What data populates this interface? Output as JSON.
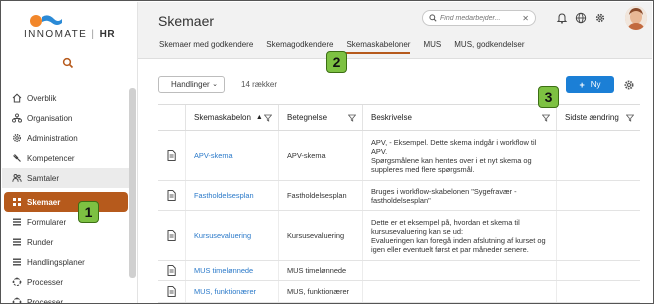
{
  "app": {
    "logo_text": "INNOMATE",
    "logo_hr": "HR"
  },
  "sidebar": {
    "items": [
      {
        "label": "Overblik",
        "icon": "home-icon"
      },
      {
        "label": "Organisation",
        "icon": "organisation-icon"
      },
      {
        "label": "Administration",
        "icon": "gear-icon"
      },
      {
        "label": "Kompetencer",
        "icon": "gavel-icon"
      },
      {
        "label": "Samtaler",
        "icon": "people-icon"
      },
      {
        "label": "Skemaer",
        "icon": "grid-icon"
      },
      {
        "label": "Formularer",
        "icon": "list-icon"
      },
      {
        "label": "Runder",
        "icon": "list-icon"
      },
      {
        "label": "Handlingsplaner",
        "icon": "list-icon"
      },
      {
        "label": "Processer",
        "icon": "process-icon"
      },
      {
        "label": "Processer",
        "icon": "process-icon"
      }
    ]
  },
  "header": {
    "title": "Skemaer",
    "search_placeholder": "Find medarbejder...",
    "search_clear": "✕",
    "tabs": [
      {
        "label": "Skemaer med godkendere"
      },
      {
        "label": "Skemagodkendere"
      },
      {
        "label": "Skemaskabeloner"
      },
      {
        "label": "MUS"
      },
      {
        "label": "MUS, godkendelser"
      }
    ]
  },
  "toolbar": {
    "actions_label": "Handlinger",
    "row_count": "14 rækker",
    "new_label": "Ny"
  },
  "table": {
    "columns": [
      "Skemaskabelon",
      "Betegnelse",
      "Beskrivelse",
      "Sidste ændring"
    ],
    "rows": [
      {
        "name": "APV-skema",
        "betegnelse": "APV-skema",
        "beskrivelse": "APV, - Eksempel. Dette skema indgår i workflow til APV.\nSpørgsmålene kan hentes over i et nyt skema og suppleres med flere spørgsmål.",
        "sidste": ""
      },
      {
        "name": "Fastholdelsesplan",
        "betegnelse": "Fastholdelsesplan",
        "beskrivelse": "Bruges i workflow-skabelonen \"Sygefravær - fastholdelsesplan\"",
        "sidste": ""
      },
      {
        "name": "Kursusevaluering",
        "betegnelse": "Kursusevaluering",
        "beskrivelse": "Dette er et eksempel på, hvordan et skema til kursusevaluering kan se ud:\nEvalueringen kan foregå inden afslutning af kurset og igen eller eventuelt først et par måneder senere.",
        "sidste": ""
      },
      {
        "name": "MUS timelønnede",
        "betegnelse": "MUS timelønnede",
        "beskrivelse": "",
        "sidste": ""
      },
      {
        "name": "MUS, funktionærer",
        "betegnelse": "MUS, funktionærer",
        "beskrivelse": "",
        "sidste": ""
      }
    ]
  },
  "callouts": [
    "1",
    "2",
    "3"
  ],
  "colors": {
    "accent": "#b65a1c",
    "primary": "#1b7fd6",
    "link": "#2a79c9",
    "callout": "#7dc142"
  }
}
